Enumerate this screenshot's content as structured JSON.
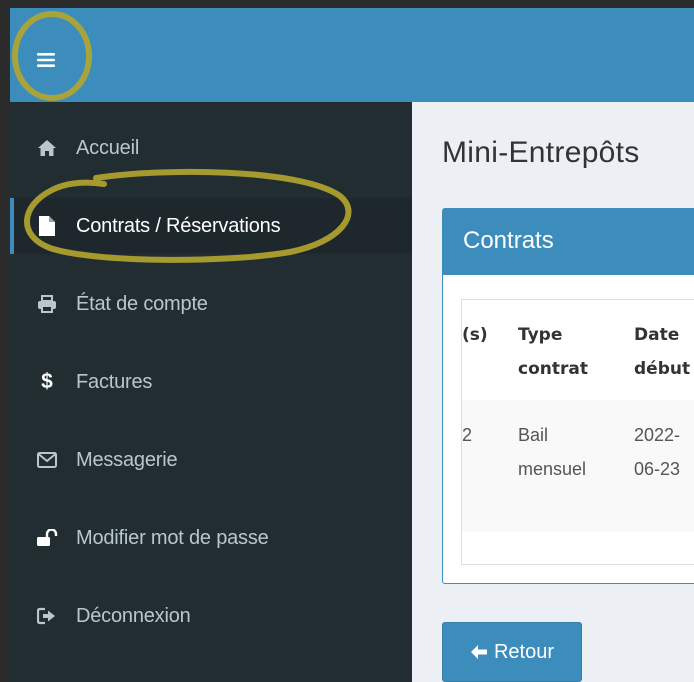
{
  "header": {
    "menu_icon": "bars-icon",
    "color": "#3c8dbc"
  },
  "sidebar": {
    "items": [
      {
        "label": "Accueil",
        "icon": "home-icon"
      },
      {
        "label": "Contrats / Réservations",
        "icon": "file-icon",
        "active": true
      },
      {
        "label": "État de compte",
        "icon": "print-icon"
      },
      {
        "label": "Factures",
        "icon": "dollar-icon"
      },
      {
        "label": "Messagerie",
        "icon": "envelope-icon"
      },
      {
        "label": "Modifier mot de passe",
        "icon": "unlock-icon"
      },
      {
        "label": "Déconnexion",
        "icon": "sign-out-icon"
      }
    ]
  },
  "main": {
    "title": "Mini-Entrepôts",
    "box_title": "Contrats",
    "table": {
      "headers": [
        [
          "(s)"
        ],
        [
          "Type",
          "contrat"
        ],
        [
          "Date",
          "début"
        ]
      ],
      "rows": [
        [
          [
            "2"
          ],
          [
            "Bail",
            "mensuel"
          ],
          [
            "2022-",
            "06-23"
          ]
        ]
      ]
    },
    "back_button": {
      "label": "Retour",
      "icon": "arrow-left-icon"
    }
  },
  "annotations": {
    "color": "#b5a52e"
  }
}
